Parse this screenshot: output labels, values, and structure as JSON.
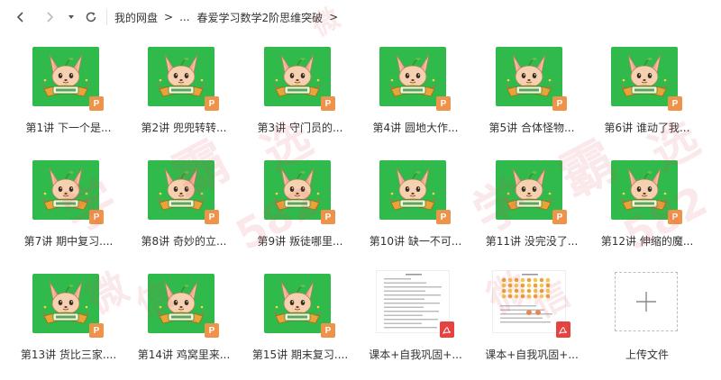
{
  "nav": {
    "back_icon": "chevron-left-icon",
    "forward_icon": "chevron-right-icon",
    "dropdown_icon": "caret-down-icon",
    "refresh_icon": "refresh-icon"
  },
  "breadcrumb": {
    "root": "我的网盘",
    "separator": ">",
    "ellipsis": "...",
    "current": "春爱学习数学2阶思维突破"
  },
  "files": [
    {
      "name": "第1讲 下一个是...",
      "type": "ppt"
    },
    {
      "name": "第2讲 兜兜转转...",
      "type": "ppt"
    },
    {
      "name": "第3讲 守门员的...",
      "type": "ppt"
    },
    {
      "name": "第4讲 圆地大作...",
      "type": "ppt"
    },
    {
      "name": "第5讲 合体怪物...",
      "type": "ppt"
    },
    {
      "name": "第6讲 谁动了我...",
      "type": "ppt"
    },
    {
      "name": "第7讲 期中复习....",
      "type": "ppt"
    },
    {
      "name": "第8讲 奇妙的立...",
      "type": "ppt"
    },
    {
      "name": "第9讲 叛徒哪里...",
      "type": "ppt"
    },
    {
      "name": "第10讲 缺一不可...",
      "type": "ppt"
    },
    {
      "name": "第11讲 没完没了...",
      "type": "ppt"
    },
    {
      "name": "第12讲 伸缩的魔...",
      "type": "ppt"
    },
    {
      "name": "第13讲 货比三家....",
      "type": "ppt"
    },
    {
      "name": "第14讲 鸡窝里来...",
      "type": "ppt"
    },
    {
      "name": "第15讲 期末复习....",
      "type": "ppt"
    },
    {
      "name": "课本+自我巩固+...",
      "type": "pdf"
    },
    {
      "name": "课本+自我巩固+...",
      "type": "pdf"
    }
  ],
  "upload": {
    "label": "上传文件",
    "icon": "plus-icon"
  },
  "badges": {
    "ppt_letter": "P"
  },
  "colors": {
    "thumb_green": "#2fba4b",
    "ppt_orange": "#f0934a",
    "pdf_red": "#e64340"
  },
  "watermark": [
    "微",
    "信",
    "学",
    "霸",
    "选",
    "582"
  ]
}
